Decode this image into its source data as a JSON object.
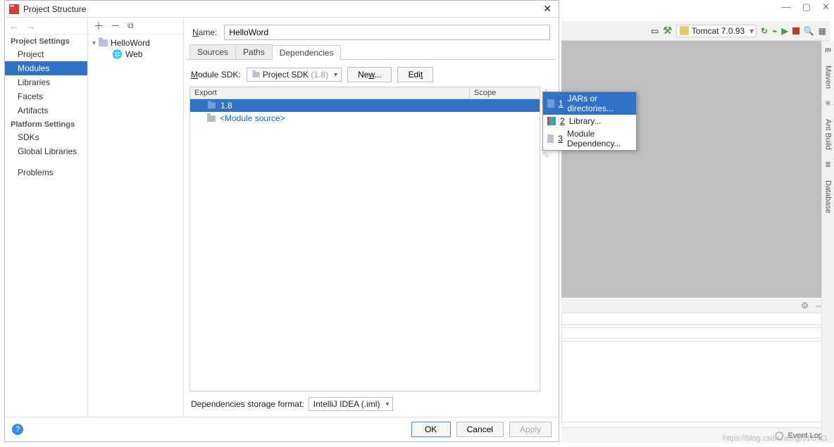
{
  "dialog": {
    "title": "Project Structure",
    "sidebar": {
      "project_settings": "Project Settings",
      "items1": [
        "Project",
        "Modules",
        "Facets",
        "Artifacts"
      ],
      "libraries": "Libraries",
      "platform_settings": "Platform Settings",
      "items2": [
        "SDKs",
        "Global Libraries"
      ],
      "problems": "Problems"
    },
    "tree": {
      "module": "HelloWord",
      "web": "Web"
    },
    "name_label_pre": "N",
    "name_label_post": "ame:",
    "name_value": "HelloWord",
    "tabs": {
      "sources": "Sources",
      "paths": "Paths",
      "dependencies": "Dependencies"
    },
    "sdk": {
      "label_pre": "M",
      "label_post": "odule SDK:",
      "combo_main": "Project SDK",
      "combo_grey": "(1.8)",
      "new": "Ne",
      "new_u": "w",
      "new_post": "...",
      "edit_pre": "Edi",
      "edit_u": "t"
    },
    "columns": {
      "export": "Export",
      "scope": "Scope"
    },
    "deps": {
      "row1": "1.8",
      "row2": "<Module source>"
    },
    "storage": {
      "label": "Dependencies storage format:",
      "value": "IntelliJ IDEA (.iml)"
    },
    "footer": {
      "ok": "OK",
      "cancel": "Cancel",
      "apply": "Apply"
    }
  },
  "popup": {
    "i1_num": "1",
    "i1": "JARs or directories...",
    "i2_num": "2",
    "i2": "Library...",
    "i3_num": "3",
    "i3": "Module Dependency..."
  },
  "bg": {
    "tomcat": "Tomcat 7.0.93",
    "event_log": "Event Log",
    "maven": "Maven",
    "antbuild": "Ant Build",
    "database": "Database"
  },
  "watermark": "https://blog.csdn.net/@51CTO"
}
